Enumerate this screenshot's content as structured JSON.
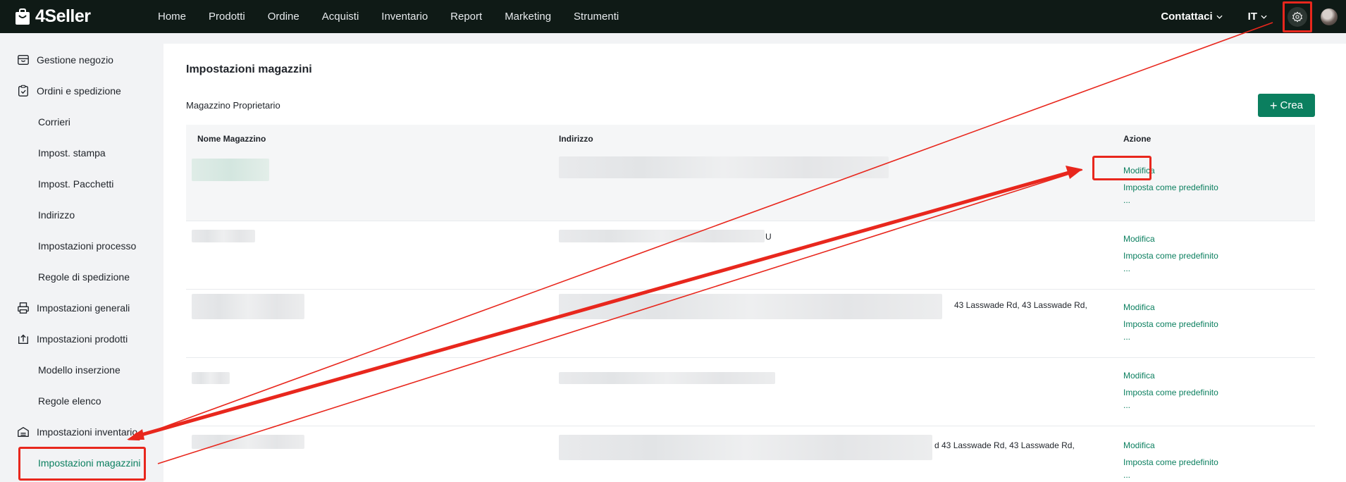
{
  "brand": {
    "name": "4Seller"
  },
  "nav": {
    "items": [
      "Home",
      "Prodotti",
      "Ordine",
      "Acquisti",
      "Inventario",
      "Report",
      "Marketing",
      "Strumenti"
    ]
  },
  "topbar": {
    "contact_label": "Contattaci",
    "language": "IT"
  },
  "sidebar": {
    "items": [
      {
        "label": "Gestione negozio",
        "icon": "store-icon"
      },
      {
        "label": "Ordini e spedizione",
        "icon": "clipboard-icon"
      },
      {
        "label": "Corrieri"
      },
      {
        "label": "Impost. stampa"
      },
      {
        "label": "Impost. Pacchetti"
      },
      {
        "label": "Indirizzo"
      },
      {
        "label": "Impostazioni processo"
      },
      {
        "label": "Regole di spedizione"
      },
      {
        "label": "Impostazioni generali",
        "icon": "printer-icon"
      },
      {
        "label": "Impostazioni prodotti",
        "icon": "upload-box-icon"
      },
      {
        "label": "Modello inserzione"
      },
      {
        "label": "Regole elenco"
      },
      {
        "label": "Impostazioni inventario",
        "icon": "warehouse-icon"
      },
      {
        "label": "Impostazioni magazzini",
        "active": true
      }
    ]
  },
  "main": {
    "title": "Impostazioni magazzini",
    "section_title": "Magazzino Proprietario",
    "create_label": "Crea",
    "columns": [
      "Nome Magazzino",
      "Indirizzo",
      "Azione"
    ],
    "rows": [
      {
        "address_suffix": "",
        "actions": [
          "Modifica",
          "Imposta come predefinito",
          "..."
        ]
      },
      {
        "address_suffix": "U",
        "actions": [
          "Modifica",
          "Imposta come predefinito",
          "..."
        ]
      },
      {
        "address_suffix": "43 Lasswade Rd, 43 Lasswade Rd,",
        "actions": [
          "Modifica",
          "Imposta come predefinito",
          "..."
        ]
      },
      {
        "address_suffix": "",
        "actions": [
          "Modifica",
          "Imposta come predefinito",
          "..."
        ]
      },
      {
        "address_suffix": "d 43 Lasswade Rd, 43 Lasswade Rd,",
        "actions": [
          "Modifica",
          "Imposta come predefinito",
          "..."
        ]
      }
    ]
  },
  "colors": {
    "accent": "#0b7f5f",
    "topbar": "#0f1a16",
    "annotation": "#e8271d"
  }
}
